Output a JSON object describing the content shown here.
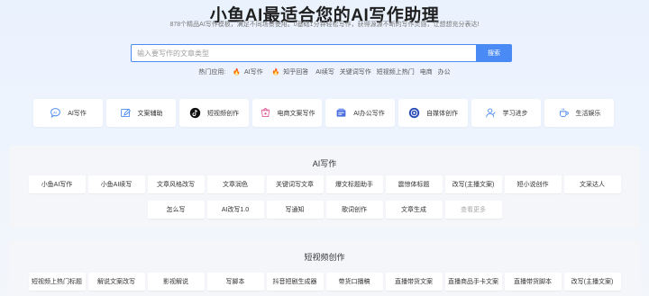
{
  "hero": {
    "title": "小鱼AI最适合您的AI写作助理",
    "subtitle": "878个精品AI写作模板，满足不同场景使用。0基础1分钟轻松写作，获得源源不断的写作灵感，让想想充分表达!"
  },
  "search": {
    "placeholder": "输入要写作的文章类型",
    "button_label": "搜索"
  },
  "hot": {
    "label": "热门应用:",
    "items": [
      "AI写作",
      "知乎回答",
      "AI续写",
      "关键词写作",
      "短视频上热门",
      "电商",
      "办公"
    ]
  },
  "categories": [
    {
      "label": "AI写作",
      "icon": "ai-chat-icon"
    },
    {
      "label": "文案辅助",
      "icon": "pen-icon"
    },
    {
      "label": "短视频创作",
      "icon": "tiktok-icon"
    },
    {
      "label": "电商文案写作",
      "icon": "shop-icon"
    },
    {
      "label": "AI办公写作",
      "icon": "office-icon"
    },
    {
      "label": "自媒体创作",
      "icon": "media-icon"
    },
    {
      "label": "学习进步",
      "icon": "learn-icon"
    },
    {
      "label": "生活娱乐",
      "icon": "cup-icon"
    }
  ],
  "sections": [
    {
      "title": "AI写作",
      "rows": [
        [
          "小鱼AI写作",
          "小鱼AI续写",
          "文章风格改写",
          "文章润色",
          "关键词写文章",
          "爆文标题助手",
          "震惊体标题",
          "改写(主播文案)",
          "短小说创作",
          "文采达人"
        ],
        [
          "怎么写",
          "AI改写1.0",
          "写通知",
          "歌词创作",
          "文章生成",
          "查看更多"
        ]
      ]
    },
    {
      "title": "短视频创作",
      "rows": [
        [
          "短视频上热门标题",
          "解说文案改写",
          "影视解说",
          "写脚本",
          "抖音短剧生成器",
          "带货口播稿",
          "直播带货文案",
          "直播商品手卡文案",
          "直播带货脚本",
          "改写(主播文案)"
        ]
      ]
    }
  ],
  "colors": {
    "accent": "#4a8af4",
    "fire": "#f0642a"
  }
}
